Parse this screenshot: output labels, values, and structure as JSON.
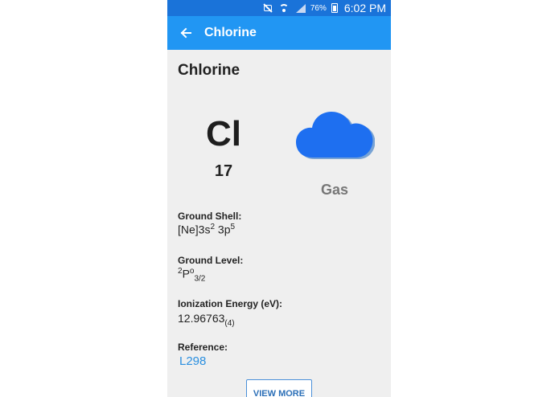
{
  "status_bar": {
    "battery_percent": "76%",
    "time": "6:02 PM"
  },
  "app_bar": {
    "back_icon": "arrow-left-icon",
    "title": "Chlorine"
  },
  "element": {
    "name": "Chlorine",
    "symbol": "Cl",
    "atomic_number": "17",
    "state": "Gas",
    "state_icon": "cloud-icon",
    "state_icon_color": "#1e6ff0"
  },
  "fields": {
    "ground_shell": {
      "label": "Ground Shell:",
      "base": "[Ne]3s",
      "sup1": "2",
      "mid": " 3p",
      "sup2": "5"
    },
    "ground_level": {
      "label": "Ground Level:",
      "sup_pre": "2",
      "base": "P",
      "sup_post": "o",
      "sub": "3/2"
    },
    "ionization_energy": {
      "label": "Ionization  Energy (eV):",
      "value": "12.96763",
      "sub": "(4)"
    },
    "reference": {
      "label": "Reference:",
      "value": "L298"
    }
  },
  "actions": {
    "view_more": "VIEW MORE"
  },
  "colors": {
    "status_bar": "#1a73d9",
    "app_bar": "#2196f3",
    "background": "#efefef",
    "link": "#2a8fe0"
  }
}
